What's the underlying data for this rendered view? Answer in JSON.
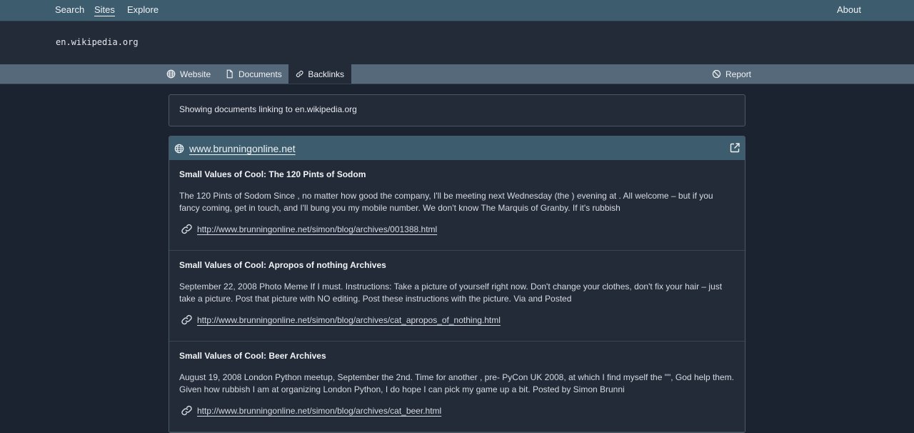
{
  "topnav": {
    "search": "Search",
    "sites": "Sites",
    "explore": "Explore",
    "about": "About"
  },
  "site": {
    "domain": "en.wikipedia.org"
  },
  "tabs": {
    "website": "Website",
    "documents": "Documents",
    "backlinks": "Backlinks",
    "report": "Report"
  },
  "notice": "Showing documents linking to en.wikipedia.org",
  "result": {
    "site": "www.brunningonline.net",
    "entries": [
      {
        "title": "Small Values of Cool: The 120 Pints of Sodom",
        "description": "The 120 Pints of Sodom Since , no matter how good the company, I'll be meeting next Wednesday (the ) evening at . All welcome – but if you fancy coming, get in touch, and I'll bung you my mobile number. We don't know The Marquis of Granby. If it's rubbish",
        "url": "http://www.brunningonline.net/simon/blog/archives/001388.html"
      },
      {
        "title": "Small Values of Cool: Apropos of nothing Archives",
        "description": "September 22, 2008 Photo Meme If I must. Instructions: Take a picture of yourself right now. Don't change your clothes, don't fix your hair – just take a picture. Post that picture with NO editing. Post these instructions with the picture. Via and Posted",
        "url": "http://www.brunningonline.net/simon/blog/archives/cat_apropos_of_nothing.html"
      },
      {
        "title": "Small Values of Cool: Beer Archives",
        "description": "August 19, 2008 London Python meetup, September the 2nd. Time for another , pre- PyCon UK 2008, at which I find myself the \"\", God help them. Given how rubbish I am at organizing London Python, I do hope I can pick my game up a bit. Posted by Simon Brunni",
        "url": "http://www.brunningonline.net/simon/blog/archives/cat_beer.html"
      }
    ]
  }
}
